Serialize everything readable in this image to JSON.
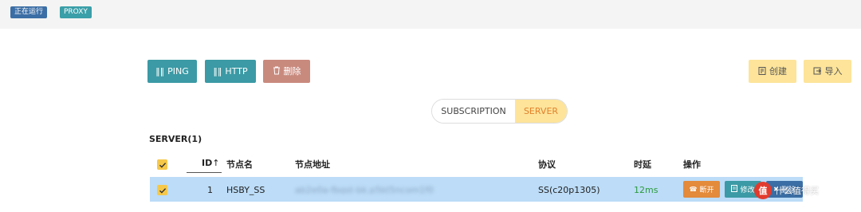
{
  "status": {
    "running_label": "正在运行",
    "mode_label": "PROXY"
  },
  "toolbar": {
    "ping_label": "PING",
    "http_label": "HTTP",
    "delete_label": "删除",
    "create_label": "创建",
    "import_label": "导入"
  },
  "tabs": {
    "subscription_label": "SUBSCRIPTION",
    "server_label": "SERVER",
    "selected": "SERVER"
  },
  "section": {
    "title": "SERVER(1)"
  },
  "table": {
    "headers": {
      "id": "ID",
      "sort_indicator": "↑",
      "name": "节点名",
      "address": "节点地址",
      "protocol": "协议",
      "latency": "时延",
      "actions": "操作"
    },
    "rows": [
      {
        "checked": true,
        "id": "1",
        "name": "HSBY_SS",
        "address": "ab2e0a-fbgst-bk.p5kt5ncom1f0",
        "protocol": "SS(c20p1305)",
        "latency": "12ms",
        "actions": {
          "disconnect": "断开",
          "edit": "修改",
          "delete": "删除"
        }
      }
    ]
  },
  "watermark": {
    "logo_text": "值",
    "text": "什么值得买"
  },
  "colors": {
    "teal": "#3b9aa5",
    "blue": "#3b6ea5",
    "salmon": "#c98a7e",
    "yellow": "#fde49a",
    "orange": "#e38a3b",
    "row_selected": "#bcdcf7",
    "latency_green": "#2b9a3e"
  }
}
